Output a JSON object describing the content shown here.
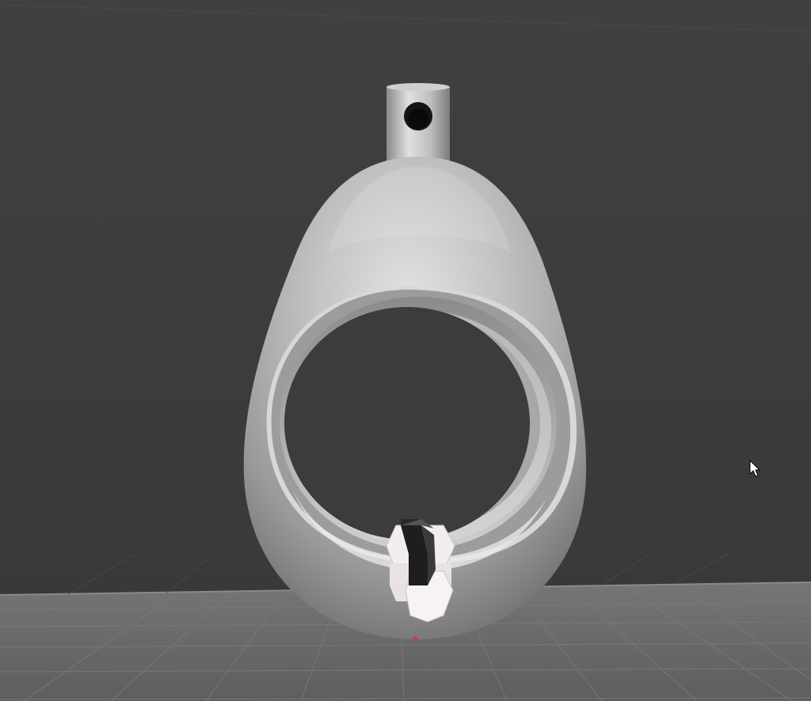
{
  "viewport": {
    "background_color": "#3d3c3b",
    "floor_color": "#6b6b6b",
    "grid_line_color": "#7f7f7f",
    "model_color": "#b8b8b8",
    "model_highlight_color": "#efefef",
    "hex_nut_color": "#f2eeee",
    "cursor_icon": "mouse-pointer-icon",
    "model_name": "egg-shaped-ring-pendant-with-bail-and-hex-pin"
  }
}
